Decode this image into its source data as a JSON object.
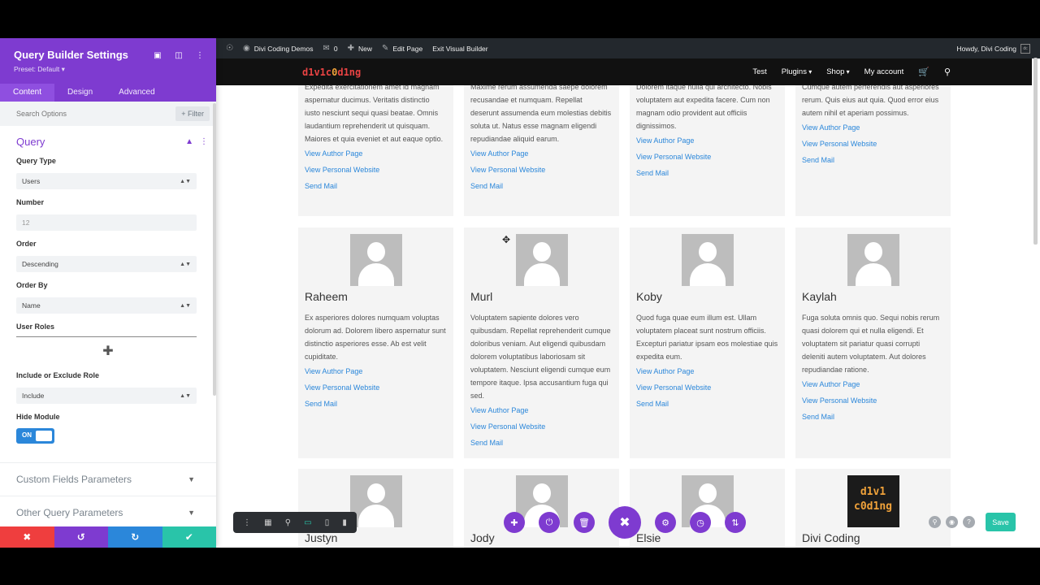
{
  "panel": {
    "title": "Query Builder Settings",
    "preset": "Preset: Default ▾",
    "tabs": [
      "Content",
      "Design",
      "Advanced"
    ],
    "search_placeholder": "Search Options",
    "filter_label": "+ Filter",
    "section_title": "Query",
    "fields": {
      "query_type_label": "Query Type",
      "query_type_value": "Users",
      "number_label": "Number",
      "number_placeholder": "12",
      "order_label": "Order",
      "order_value": "Descending",
      "order_by_label": "Order By",
      "order_by_value": "Name",
      "user_roles_label": "User Roles",
      "include_label": "Include or Exclude Role",
      "include_value": "Include",
      "hide_label": "Hide Module",
      "toggle_on": "ON"
    },
    "collapsed": [
      "Custom Fields Parameters",
      "Other Query Parameters"
    ]
  },
  "adminbar": {
    "site": "Divi Coding Demos",
    "comments": "0",
    "new": "New",
    "edit": "Edit Page",
    "exit": "Exit Visual Builder",
    "howdy": "Howdy, Divi Coding"
  },
  "site": {
    "logo_a": "d1v1c",
    "logo_b": "0",
    "logo_c": "d1ng",
    "nav": [
      "Test",
      "Plugins",
      "Shop",
      "My account"
    ]
  },
  "links": {
    "author": "View Author Page",
    "website": "View Personal Website",
    "mail": "Send Mail"
  },
  "top_cards": [
    {
      "bio": "Expedita exercitationem amet id magnam aspernatur ducimus. Veritatis distinctio iusto nesciunt sequi quasi beatae. Omnis laudantium reprehenderit ut quisquam. Maiores et quia eveniet et aut eaque optio."
    },
    {
      "bio": "Maxime rerum assumenda saepe dolorem recusandae et numquam. Repellat deserunt assumenda eum molestias debitis soluta ut. Natus esse magnam eligendi repudiandae aliquid earum."
    },
    {
      "bio": "Dolorem itaque nulla qui architecto. Nobis voluptatem aut expedita facere. Cum non magnam odio provident aut officiis dignissimos."
    },
    {
      "bio": "Cumque autem perferendis aut asperiores rerum. Quis eius aut quia. Quod error eius autem nihil et aperiam possimus."
    }
  ],
  "mid_cards": [
    {
      "name": "Raheem",
      "bio": "Ex asperiores dolores numquam voluptas dolorum ad. Dolorem libero aspernatur sunt distinctio asperiores esse. Ab est velit cupiditate."
    },
    {
      "name": "Murl",
      "bio": "Voluptatem sapiente dolores vero quibusdam. Repellat reprehenderit cumque doloribus veniam. Aut eligendi quibusdam dolorem voluptatibus laboriosam sit voluptatem. Nesciunt eligendi cumque eum tempore itaque. Ipsa accusantium fuga qui sed."
    },
    {
      "name": "Koby",
      "bio": "Quod fuga quae eum illum est. Ullam voluptatem placeat sunt nostrum officiis. Excepturi pariatur ipsam eos molestiae quis expedita eum."
    },
    {
      "name": "Kaylah",
      "bio": "Fuga soluta omnis quo. Sequi nobis rerum quasi dolorem qui et nulla eligendi. Et voluptatem sit pariatur quasi corrupti deleniti autem voluptatem. Aut dolores repudiandae ratione."
    }
  ],
  "bottom_cards": [
    {
      "name": "Justyn"
    },
    {
      "name": "Jody"
    },
    {
      "name": "Elsie"
    },
    {
      "name": "Divi Coding",
      "logo": "d1v1\nc0d1ng"
    }
  ],
  "builder": {
    "save": "Save"
  },
  "colors": {
    "divi_purple": "#7e3bd0",
    "link_blue": "#2b87da",
    "save_green": "#29c4a9",
    "cancel_red": "#ef3e3e",
    "undo_purple": "#7e3bd0",
    "redo_blue": "#2b87da"
  }
}
